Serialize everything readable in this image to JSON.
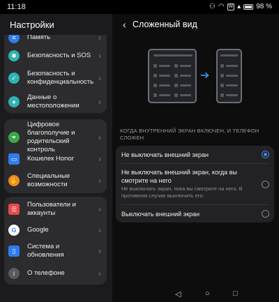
{
  "status_bar": {
    "time": "11:18",
    "battery": "98 %",
    "icons": [
      "notification-icon",
      "wifi-icon",
      "vowifi-icon",
      "signal-icon",
      "battery-icon"
    ]
  },
  "left_pane": {
    "title": "Настройки",
    "groups": [
      {
        "items": [
          {
            "label": "Память",
            "icon": "storage-icon",
            "color": "#2f7cf0"
          },
          {
            "label": "Безопасность и SOS",
            "icon": "sos-icon",
            "color": "#2fb4b4"
          },
          {
            "label": "Безопасность и конфиденциальность",
            "icon": "shield-icon",
            "color": "#2fb4b4"
          },
          {
            "label": "Данные о местоположении",
            "icon": "location-icon",
            "color": "#2fb4b4"
          }
        ]
      },
      {
        "items": [
          {
            "label": "Цифровое благополучие и родительский контроль",
            "icon": "wellbeing-icon",
            "color": "#3aa94b"
          },
          {
            "label": "Кошелек Honor",
            "icon": "wallet-icon",
            "color": "#2f7cf0"
          },
          {
            "label": "Специальные возможности",
            "icon": "accessibility-icon",
            "color": "#f08a24"
          }
        ]
      },
      {
        "items": [
          {
            "label": "Пользователи и аккаунты",
            "icon": "user-icon",
            "color": "#e94848"
          },
          {
            "label": "Google",
            "icon": "google-icon",
            "color": "#ffffff"
          },
          {
            "label": "Система и обновления",
            "icon": "system-icon",
            "color": "#2f7cf0"
          },
          {
            "label": "О телефоне",
            "icon": "info-icon",
            "color": "#5a5a5e"
          }
        ]
      }
    ]
  },
  "right_pane": {
    "title": "Сложенный вид",
    "section_caption": "КОГДА ВНУТРЕННИЙ ЭКРАН ВКЛЮЧЕН, И ТЕЛЕФОН СЛОЖЕН",
    "options": [
      {
        "title": "Не выключать внешний экран",
        "subtitle": "",
        "selected": true
      },
      {
        "title": "Не выключать внешний экран, когда вы смотрите на него",
        "subtitle": "Не выключать экран, пока вы смотрите на него. В противном случае выключить его.",
        "selected": false
      },
      {
        "title": "Выключать внешний экран",
        "subtitle": "",
        "selected": false
      }
    ]
  },
  "nav_bar": {
    "back": "◁",
    "home": "○",
    "recents": "□"
  },
  "colors": {
    "accent": "#3f88e6",
    "card": "#2c2c2e",
    "background": "#0d0d0e"
  }
}
